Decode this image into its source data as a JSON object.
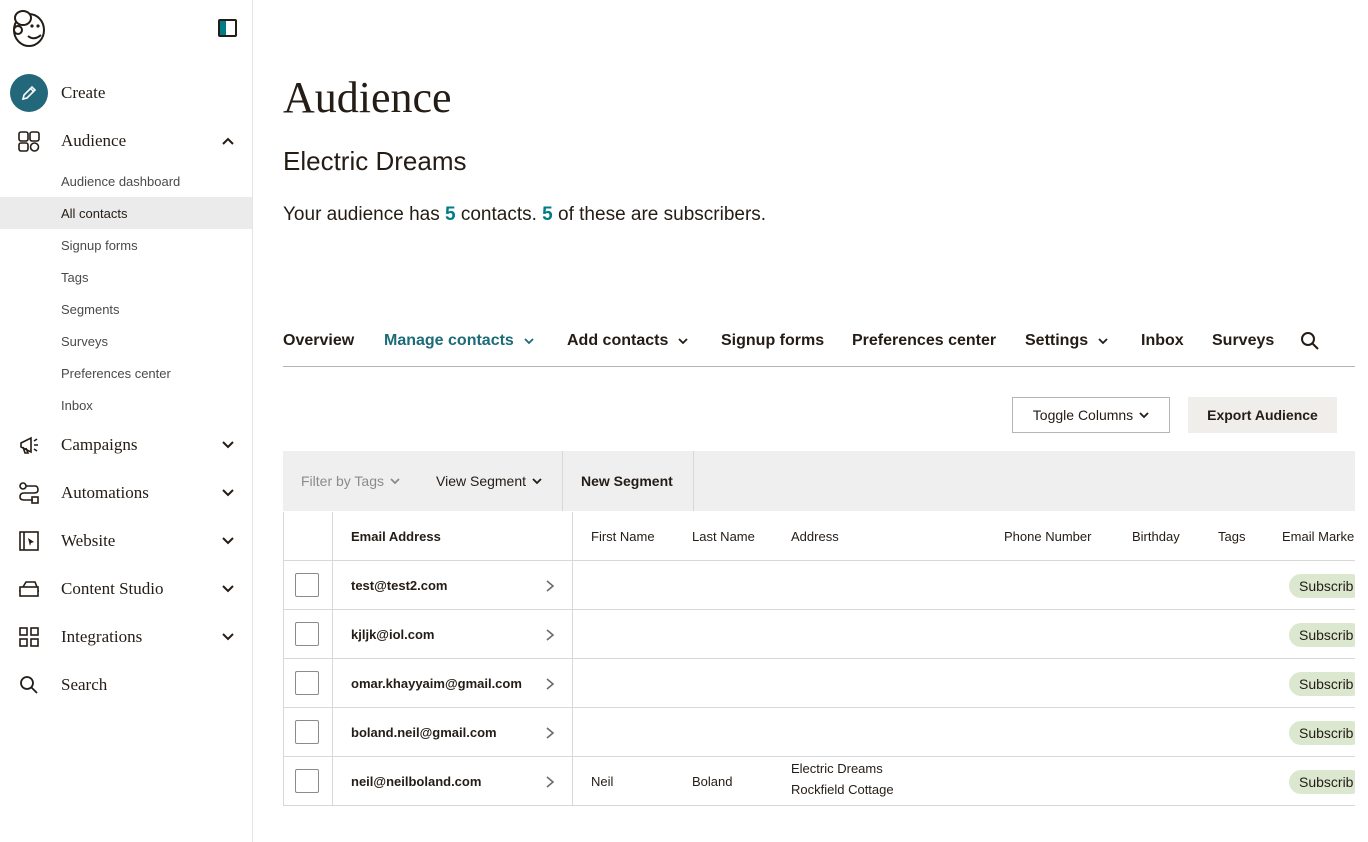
{
  "sidebar": {
    "nav": [
      {
        "label": "Create",
        "icon": "pencil-icon"
      },
      {
        "label": "Audience",
        "icon": "audience-icon"
      },
      {
        "label": "Campaigns",
        "icon": "megaphone-icon"
      },
      {
        "label": "Automations",
        "icon": "automation-icon"
      },
      {
        "label": "Website",
        "icon": "website-icon"
      },
      {
        "label": "Content Studio",
        "icon": "content-studio-icon"
      },
      {
        "label": "Integrations",
        "icon": "grid-icon"
      },
      {
        "label": "Search",
        "icon": "search-icon"
      }
    ],
    "audience_sub": [
      {
        "label": "Audience dashboard"
      },
      {
        "label": "All contacts",
        "active": true
      },
      {
        "label": "Signup forms"
      },
      {
        "label": "Tags"
      },
      {
        "label": "Segments"
      },
      {
        "label": "Surveys"
      },
      {
        "label": "Preferences center"
      },
      {
        "label": "Inbox"
      }
    ]
  },
  "page": {
    "title": "Audience",
    "audience_name": "Electric Dreams",
    "summary_prefix": "Your audience has ",
    "contacts_count": "5",
    "summary_middle": " contacts. ",
    "subscribers_count": "5",
    "summary_suffix": " of these are subscribers."
  },
  "tabs": [
    {
      "label": "Overview"
    },
    {
      "label": "Manage contacts",
      "active": true
    },
    {
      "label": "Add contacts"
    },
    {
      "label": "Signup forms"
    },
    {
      "label": "Preferences center"
    },
    {
      "label": "Settings"
    },
    {
      "label": "Inbox"
    },
    {
      "label": "Surveys"
    }
  ],
  "toolbar": {
    "toggle_columns": "Toggle Columns",
    "export": "Export Audience",
    "filter_tags": "Filter by Tags",
    "view_segment": "View Segment",
    "new_segment": "New Segment"
  },
  "table": {
    "headers": [
      "Email Address",
      "First Name",
      "Last Name",
      "Address",
      "Phone Number",
      "Birthday",
      "Tags",
      "Email Marke"
    ],
    "rows": [
      {
        "email": "test@test2.com",
        "first": "",
        "last": "",
        "address1": "",
        "address2": "",
        "status": "Subscrib"
      },
      {
        "email": "kjljk@iol.com",
        "first": "",
        "last": "",
        "address1": "",
        "address2": "",
        "status": "Subscrib"
      },
      {
        "email": "omar.khayyaim@gmail.com",
        "first": "",
        "last": "",
        "address1": "",
        "address2": "",
        "status": "Subscrib"
      },
      {
        "email": "boland.neil@gmail.com",
        "first": "",
        "last": "",
        "address1": "",
        "address2": "",
        "status": "Subscrib"
      },
      {
        "email": "neil@neilboland.com",
        "first": "Neil",
        "last": "Boland",
        "address1": "Electric Dreams",
        "address2": "Rockfield Cottage",
        "status": "Subscrib"
      }
    ]
  },
  "colors": {
    "accent": "#007c89",
    "create_circle": "#23677a",
    "badge": "#dbe8cf"
  }
}
